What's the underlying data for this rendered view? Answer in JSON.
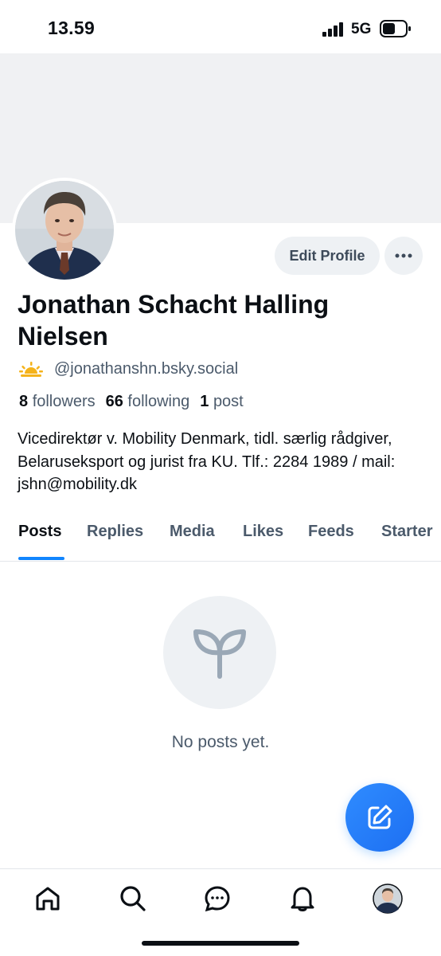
{
  "status_bar": {
    "time": "13.59",
    "network": "5G"
  },
  "profile": {
    "name": "Jonathan Schacht Halling Nielsen",
    "handle": "@jonathanshn.bsky.social",
    "followers_count": "8",
    "followers_label": "followers",
    "following_count": "66",
    "following_label": "following",
    "posts_count": "1",
    "posts_label": "post",
    "bio": "Vicedirektør v. Mobility Denmark, tidl. særlig rådgiver, Belaruseksport og jurist fra KU. Tlf.: 2284 1989 / mail: jshn@mobility.dk"
  },
  "actions": {
    "edit_profile": "Edit Profile",
    "more_icon": "ellipsis-icon"
  },
  "tabs": [
    {
      "label": "Posts",
      "active": true
    },
    {
      "label": "Replies",
      "active": false
    },
    {
      "label": "Media",
      "active": false
    },
    {
      "label": "Likes",
      "active": false
    },
    {
      "label": "Feeds",
      "active": false
    },
    {
      "label": "Starter",
      "active": false
    }
  ],
  "empty_state": {
    "icon": "sprout-icon",
    "text": "No posts yet."
  },
  "fab": {
    "icon": "compose-icon"
  },
  "bottom_nav": [
    {
      "icon": "home-icon"
    },
    {
      "icon": "search-icon"
    },
    {
      "icon": "chat-icon"
    },
    {
      "icon": "bell-icon"
    },
    {
      "icon": "avatar-icon"
    }
  ],
  "colors": {
    "accent": "#1185fe",
    "banner": "#f0f1f3",
    "muted_text": "#4b5a6b"
  }
}
